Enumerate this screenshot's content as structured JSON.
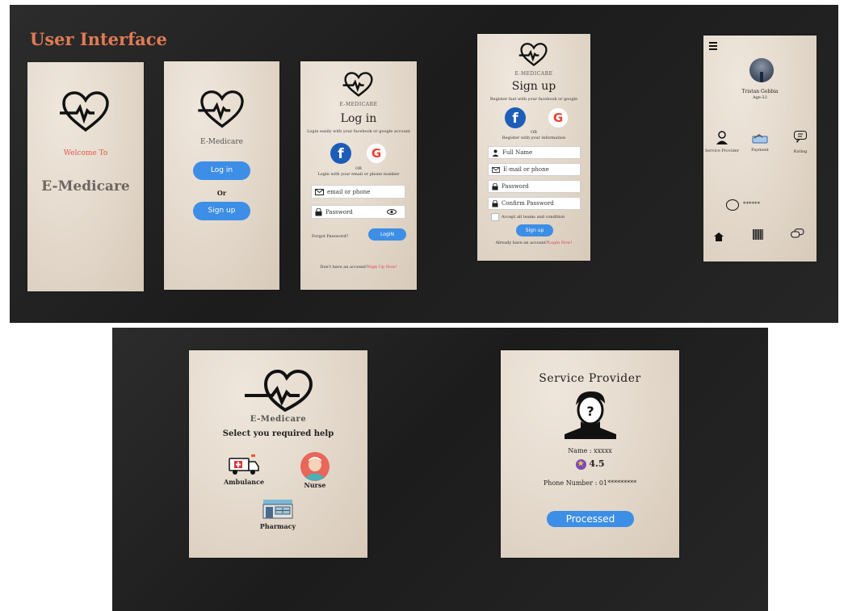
{
  "slide1": {
    "title": "User Interface"
  },
  "welcome": {
    "welcome_to": "Welcome To",
    "app_name": "E-Medicare"
  },
  "choice": {
    "app_name": "E-Medicare",
    "login_button": "Log in",
    "or": "Or",
    "signup_button": "Sign up"
  },
  "login": {
    "brand": "E-MEDICARE",
    "title": "Log in",
    "subtitle": "Login easily with your facebook or google account",
    "or": "OR",
    "alt_text": "Login with your email or phone number",
    "email_placeholder": "email or phone",
    "password_placeholder": "Password",
    "forgot": "Forgot Password?",
    "login_button": "LogIN",
    "no_account": "Don't have an account?",
    "signup_link": "Sign Up Now!"
  },
  "signup": {
    "brand": "E-MEDICARE",
    "title": "Sign up",
    "subtitle": "Register fast with your facebook or google",
    "or": "OR",
    "alt_text": "Register with your information",
    "full_name": "Full Name",
    "email": "E-mail or phone",
    "password": "Password",
    "confirm_password": "Confirm Password",
    "terms": "Accept all teams and condition",
    "signup_button": "Sign up",
    "have_account": "Already have an account?",
    "login_link": "Login Now!"
  },
  "dashboard": {
    "user_name": "Tristan Gebbia",
    "user_age": "Age-22",
    "services": [
      {
        "label": "Service Provider",
        "icon": "service-provider-icon"
      },
      {
        "label": "Payment",
        "icon": "payment-icon"
      },
      {
        "label": "Rating",
        "icon": "rating-icon"
      }
    ],
    "masked": "******"
  },
  "help": {
    "app_name": "E-Medicare",
    "title": "Select you required help",
    "options": [
      {
        "label": "Ambulance",
        "icon": "ambulance-icon"
      },
      {
        "label": "Nurse",
        "icon": "nurse-icon"
      },
      {
        "label": "Pharmacy",
        "icon": "pharmacy-icon"
      }
    ]
  },
  "provider": {
    "title": "Service Provider",
    "name": "Name : xxxxx",
    "rating": "4.5",
    "phone": "Phone Number : 01*********",
    "button": "Processed"
  },
  "colors": {
    "accent_blue": "#3d8ee6",
    "title_orange": "#e07b54",
    "link_red": "#e0364a",
    "facebook_blue": "#1c5db8"
  }
}
